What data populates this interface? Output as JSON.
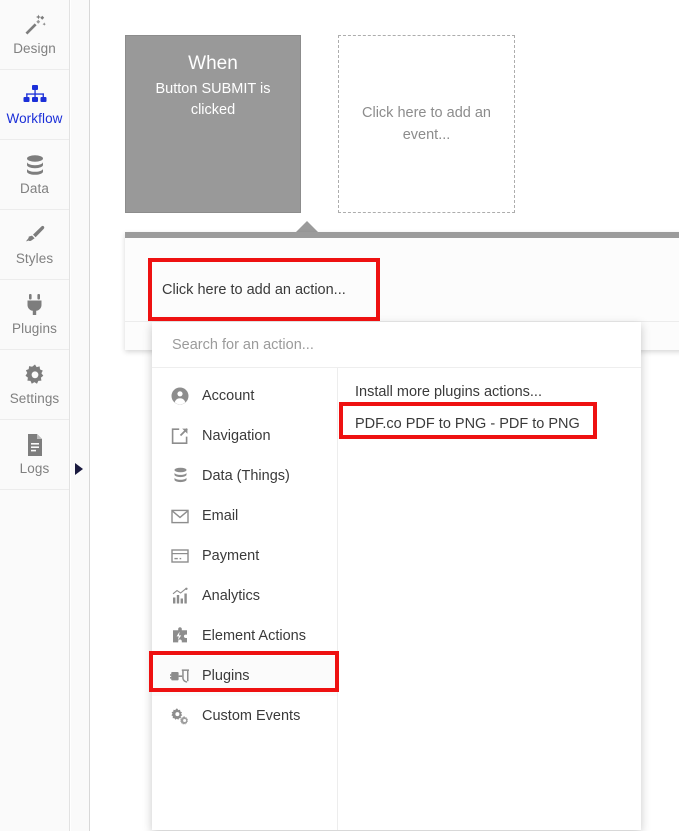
{
  "sidebar": {
    "items": [
      {
        "label": "Design",
        "icon": "wand-icon",
        "active": false
      },
      {
        "label": "Workflow",
        "icon": "sitemap-icon",
        "active": true
      },
      {
        "label": "Data",
        "icon": "database-icon",
        "active": false
      },
      {
        "label": "Styles",
        "icon": "brush-icon",
        "active": false
      },
      {
        "label": "Plugins",
        "icon": "plug-icon",
        "active": false
      },
      {
        "label": "Settings",
        "icon": "gear-icon",
        "active": false
      },
      {
        "label": "Logs",
        "icon": "document-icon",
        "active": false
      }
    ],
    "collapse_arrow_icon": "triangle-right-icon"
  },
  "canvas": {
    "event_box": {
      "title": "When",
      "subtitle": "Button SUBMIT is clicked"
    },
    "add_event_box": {
      "label": "Click here to add an event..."
    },
    "action_panel": {
      "add_action_label": "Click here to add an action..."
    }
  },
  "dropdown": {
    "search": {
      "placeholder": "Search for an action...",
      "value": ""
    },
    "categories": [
      {
        "label": "Account",
        "icon": "user-circle-icon",
        "selected": false
      },
      {
        "label": "Navigation",
        "icon": "share-arrow-icon",
        "selected": false
      },
      {
        "label": "Data (Things)",
        "icon": "database-icon",
        "selected": false
      },
      {
        "label": "Email",
        "icon": "envelope-icon",
        "selected": false
      },
      {
        "label": "Payment",
        "icon": "credit-card-icon",
        "selected": false
      },
      {
        "label": "Analytics",
        "icon": "bar-chart-icon",
        "selected": false
      },
      {
        "label": "Element Actions",
        "icon": "puzzle-bolt-icon",
        "selected": false
      },
      {
        "label": "Plugins",
        "icon": "plug-socket-icon",
        "selected": true
      },
      {
        "label": "Custom Events",
        "icon": "gears-icon",
        "selected": false
      }
    ],
    "actions": [
      {
        "label": "Install more plugins actions...",
        "highlighted": false
      },
      {
        "label": "PDF.co PDF to PNG - PDF to PNG",
        "highlighted": true
      }
    ]
  },
  "highlights": {
    "accent_color": "#ee1111",
    "targets": [
      "add-action-row",
      "plugins-category-row",
      "pdfco-action-row"
    ]
  },
  "colors": {
    "event_box_bg": "#999999",
    "sidebar_active": "#1b2fd8",
    "sidebar_text": "#808080",
    "panel_bar": "#9b9b9b"
  }
}
